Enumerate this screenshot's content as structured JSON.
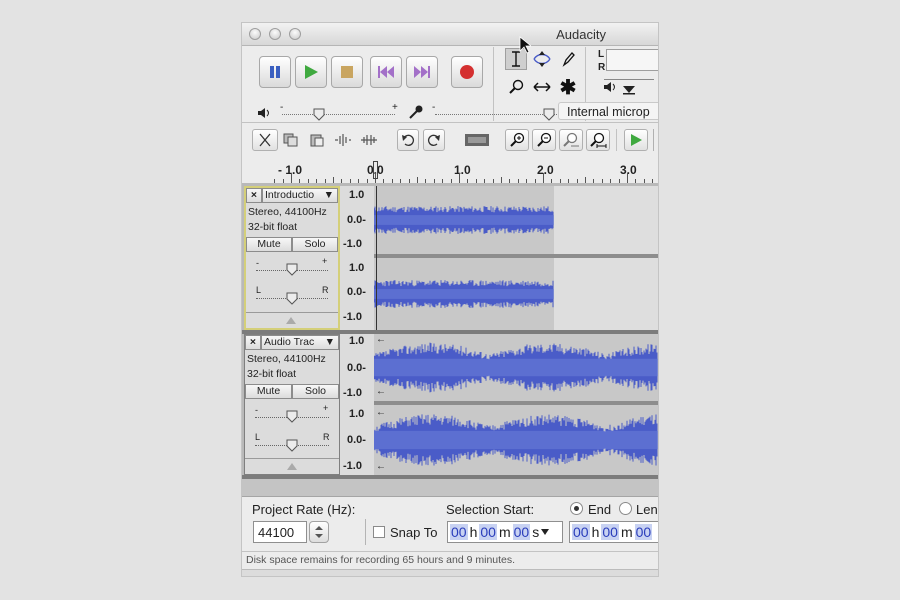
{
  "window": {
    "title": "Audacity"
  },
  "transport": [
    {
      "name": "pause-button",
      "icon": "pause-icon",
      "color": "#3a5fc0"
    },
    {
      "name": "play-button",
      "icon": "play-icon",
      "color": "#3fa93f"
    },
    {
      "name": "stop-button",
      "icon": "stop-icon",
      "color": "#c9a560"
    },
    {
      "name": "skip-to-start-button",
      "icon": "skip-start-icon",
      "color": "#a370c8"
    },
    {
      "name": "skip-to-end-button",
      "icon": "skip-end-icon",
      "color": "#a370c8"
    },
    {
      "name": "record-button",
      "icon": "record-icon",
      "color": "#d43030"
    }
  ],
  "tools": [
    "selection-tool-icon",
    "envelope-tool-icon",
    "draw-tool-icon",
    "zoom-tool-icon",
    "time-shift-tool-icon",
    "multi-tool-icon"
  ],
  "meters": {
    "left": "L",
    "right": "R"
  },
  "mixer": {
    "input_device": "Internal microp",
    "minus": "-",
    "plus": "+"
  },
  "ruler": {
    "labels": [
      "- 1.0",
      "0.0",
      "1.0",
      "2.0",
      "3.0"
    ]
  },
  "tracks": [
    {
      "name": "Introductio",
      "info1": "Stereo, 44100Hz",
      "info2": "32-bit float",
      "mute": "Mute",
      "solo": "Solo",
      "gain_min": "-",
      "gain_max": "+",
      "pan_left": "L",
      "pan_right": "R",
      "scale": [
        "1.0",
        "0.0-",
        "-1.0"
      ],
      "selected": true
    },
    {
      "name": "Audio Trac",
      "info1": "Stereo, 44100Hz",
      "info2": "32-bit float",
      "mute": "Mute",
      "solo": "Solo",
      "gain_min": "-",
      "gain_max": "+",
      "pan_left": "L",
      "pan_right": "R",
      "scale": [
        "1.0",
        "0.0-",
        "-1.0"
      ],
      "selected": false
    }
  ],
  "footer": {
    "project_rate_label": "Project Rate (Hz):",
    "project_rate_value": "44100",
    "snap_to_label": "Snap To",
    "selection_start_label": "Selection Start:",
    "end_label": "End",
    "length_label": "Len",
    "start_time": {
      "h": "00",
      "m": "00",
      "s": "00",
      "hu": "h",
      "mu": "m",
      "su": "s"
    },
    "end_time": {
      "h": "00",
      "m": "00",
      "s": "00",
      "hu": "h",
      "mu": "m"
    },
    "status": "Disk space remains for recording 65 hours and 9 minutes."
  },
  "colors": {
    "waveform": "#4a5cc8",
    "waveform_bg": "#c8c8c8",
    "selected_track_border": "#d4cf79"
  }
}
